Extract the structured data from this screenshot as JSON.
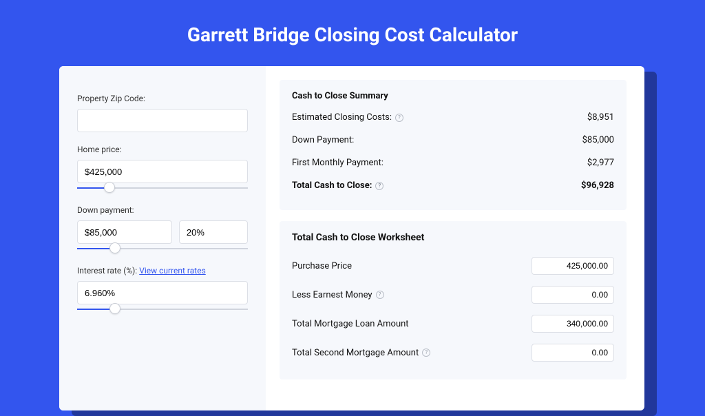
{
  "page": {
    "title": "Garrett Bridge Closing Cost Calculator"
  },
  "left": {
    "zip_label": "Property Zip Code:",
    "zip_value": "",
    "home_price_label": "Home price:",
    "home_price_value": "$425,000",
    "home_price_slider_pct": 19,
    "down_payment_label": "Down payment:",
    "down_payment_value": "$85,000",
    "down_payment_pct_value": "20%",
    "down_payment_slider_pct": 22,
    "interest_label": "Interest rate (%): ",
    "interest_link": "View current rates",
    "interest_value": "6.960%",
    "interest_slider_pct": 22
  },
  "summary": {
    "heading": "Cash to Close Summary",
    "rows": [
      {
        "label": "Estimated Closing Costs:",
        "value": "$8,951",
        "help": true
      },
      {
        "label": "Down Payment:",
        "value": "$85,000",
        "help": false
      },
      {
        "label": "First Monthly Payment:",
        "value": "$2,977",
        "help": false
      }
    ],
    "total_label": "Total Cash to Close:",
    "total_value": "$96,928"
  },
  "worksheet": {
    "heading": "Total Cash to Close Worksheet",
    "rows": [
      {
        "label": "Purchase Price",
        "value": "425,000.00",
        "help": false
      },
      {
        "label": "Less Earnest Money",
        "value": "0.00",
        "help": true
      },
      {
        "label": "Total Mortgage Loan Amount",
        "value": "340,000.00",
        "help": false
      },
      {
        "label": "Total Second Mortgage Amount",
        "value": "0.00",
        "help": true
      }
    ]
  }
}
